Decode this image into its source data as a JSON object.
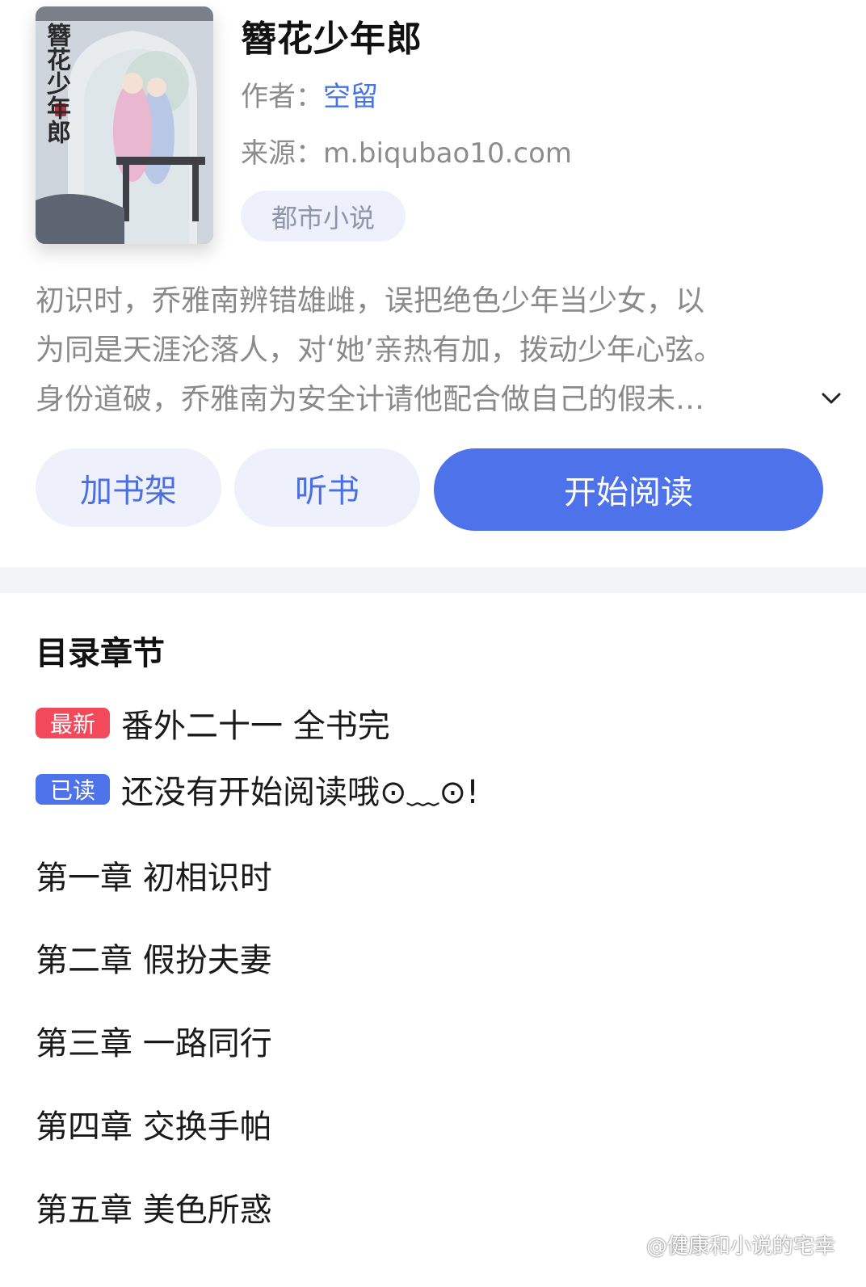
{
  "book": {
    "title": "簪花少年郎",
    "author_label": "作者：",
    "author": "空留",
    "source_label": "来源：",
    "source": "m.biqubao10.com",
    "tag": "都市小说",
    "cover_text": "簪花少年郎",
    "description_lines": [
      "初识时，乔雅南辨错雄雌，误把绝色少年当少女，以",
      "为同是天涯沦落人，对‘她’亲热有加，拨动少年心弦。",
      "身份道破，乔雅南为安全计请他配合做自己的假未…"
    ]
  },
  "actions": {
    "add_shelf": "加书架",
    "listen": "听书",
    "start_reading": "开始阅读"
  },
  "catalog": {
    "title": "目录章节",
    "latest_badge": "最新",
    "latest_chapter": "番外二十一 全书完",
    "read_badge": "已读",
    "read_status": "还没有开始阅读哦⊙﹏⊙!",
    "chapters": [
      "第一章 初相识时",
      "第二章 假扮夫妻",
      "第三章 一路同行",
      "第四章 交换手帕",
      "第五章 美色所惑"
    ]
  },
  "watermark": "@健康和小说的宅幸",
  "colors": {
    "accent": "#4e72ea",
    "link": "#4a72e6",
    "badge_new": "#f24a5a",
    "button_light_bg": "#eef0fc",
    "tag_bg": "#eef0fb",
    "divider": "#f3f4f6"
  },
  "icons": {
    "expand": "chevron-down-icon",
    "weibo": "weibo-icon"
  }
}
